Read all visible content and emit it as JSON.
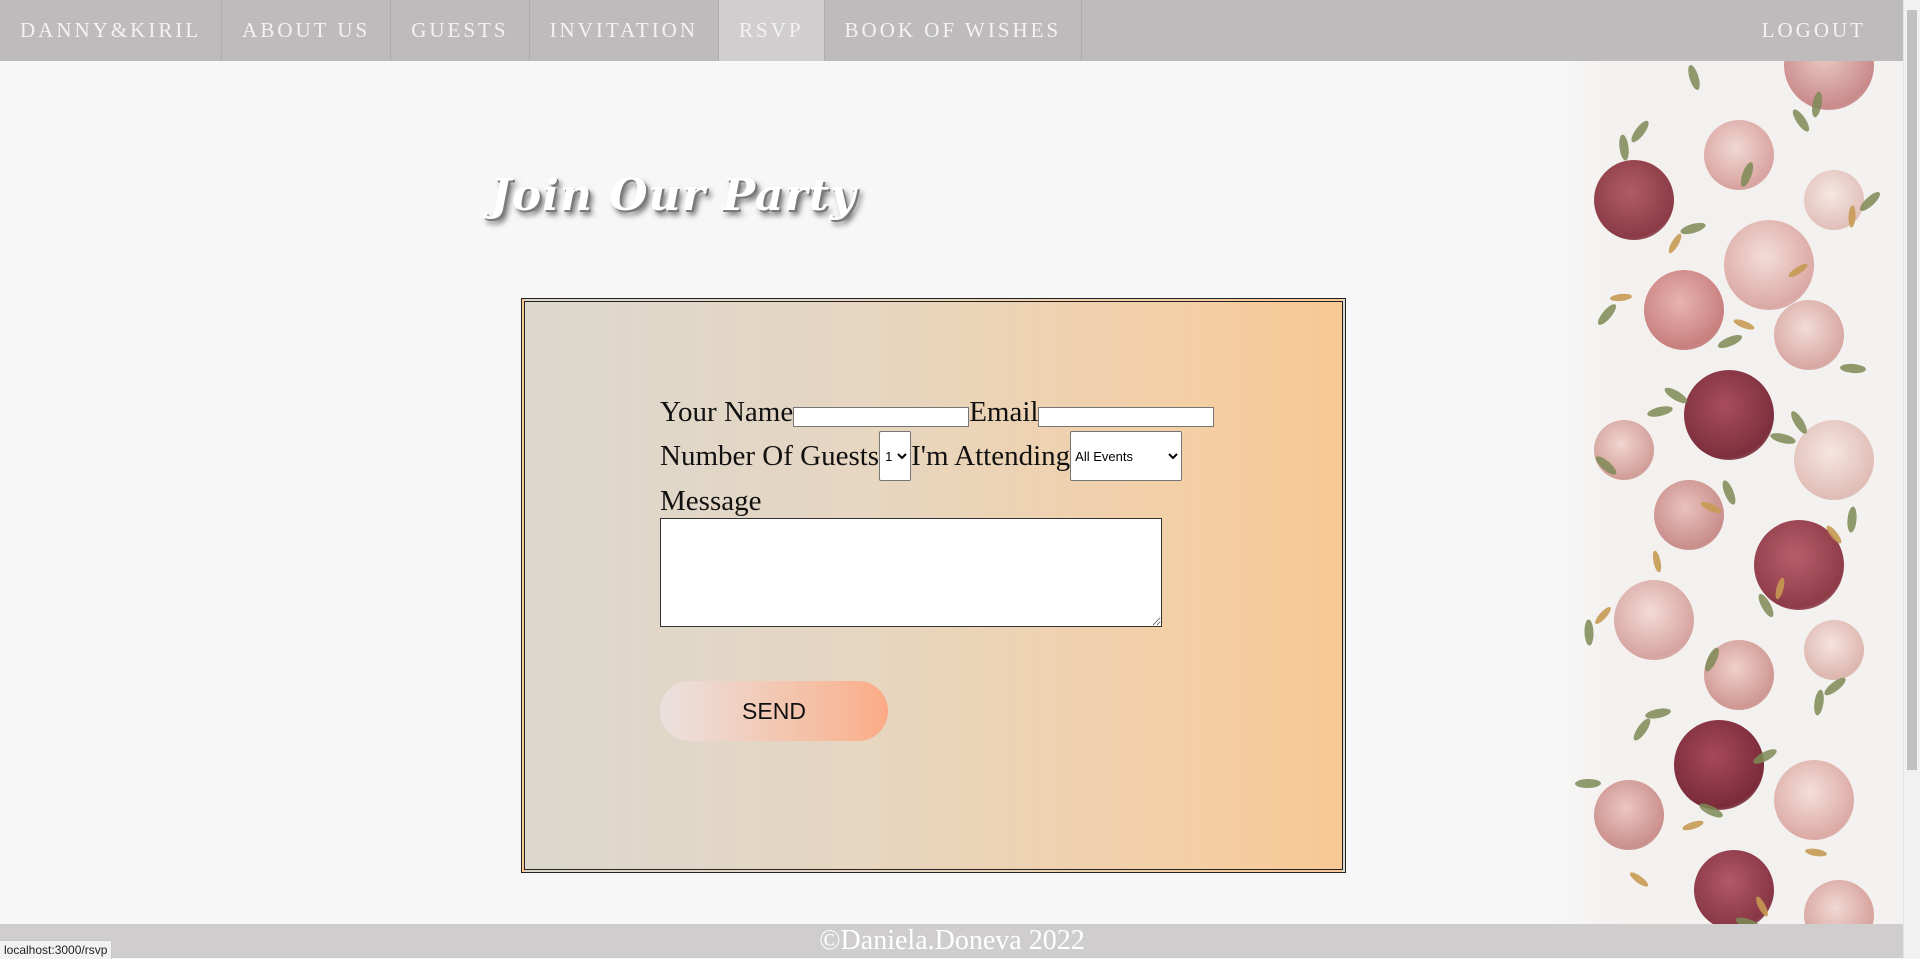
{
  "nav": {
    "items": [
      {
        "label": "DANNY&KIRIL"
      },
      {
        "label": "ABOUT US"
      },
      {
        "label": "GUESTS"
      },
      {
        "label": "INVITATION"
      },
      {
        "label": "RSVP"
      },
      {
        "label": "BOOK OF WISHES"
      }
    ],
    "active": "RSVP",
    "logout_label": "LOGOUT"
  },
  "main": {
    "title": "Join Our Party",
    "form": {
      "name_label": "Your Name",
      "name_value": "",
      "email_label": "Email",
      "email_value": "",
      "guests_label": "Number Of Guests",
      "guests_selected": "1",
      "attending_label": "I'm Attending",
      "attending_selected": "All Events",
      "message_label": "Message",
      "message_value": "",
      "send_label": "SEND"
    }
  },
  "footer": {
    "text": "©Daniela.Doneva 2022"
  },
  "status_bar": {
    "url": "localhost:3000/rsvp"
  },
  "colors": {
    "navbar_bg": "#bdbbbc",
    "nav_active_bg": "#d0cecf",
    "form_gradient_start": "#dcd8ce",
    "form_gradient_end": "#f8c895",
    "send_gradient_end": "#fca985",
    "footer_bg": "#cfcdcd"
  }
}
